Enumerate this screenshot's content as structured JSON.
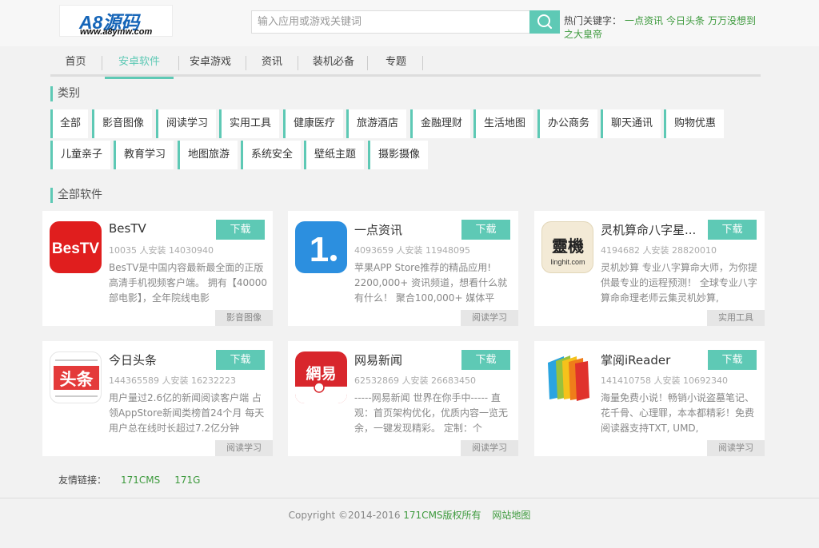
{
  "header": {
    "logo_main": "A8源码",
    "logo_url": "www.a8ymw.com",
    "search_placeholder": "输入应用或游戏关键词",
    "hot_label": "热门关键字：",
    "hot_keywords": [
      "一点资讯",
      "今日头条",
      "万万没想到之大皇帝"
    ]
  },
  "nav": [
    "首页",
    "安卓软件",
    "安卓游戏",
    "资讯",
    "装机必备",
    "专题"
  ],
  "nav_active": "安卓软件",
  "category_title": "类别",
  "categories": [
    "全部",
    "影音图像",
    "阅读学习",
    "实用工具",
    "健康医疗",
    "旅游酒店",
    "金融理财",
    "生活地图",
    "办公商务",
    "聊天通讯",
    "购物优惠",
    "儿童亲子",
    "教育学习",
    "地图旅游",
    "系统安全",
    "壁纸主题",
    "摄影摄像"
  ],
  "list_title": "全部软件",
  "download_label": "下载",
  "apps": [
    {
      "name": "BesTV",
      "stats": "10035 人安装 14030940",
      "desc": "BesTV是中国内容最新最全面的正版高清手机视频客户端。 拥有【40000部电影】，全年院线电影",
      "category": "影音图像",
      "icon": "bestv-icon"
    },
    {
      "name": "一点资讯",
      "stats": "4093659 人安装 11948095",
      "desc": "苹果APP Store推荐的精品应用! 2200,000+ 资讯频道，想看什么就有什么！ 聚合100,000+ 媒体平",
      "category": "阅读学习",
      "icon": "yidian-icon"
    },
    {
      "name": "灵机算命八字星...",
      "stats": "4194682 人安装 28820010",
      "desc": "灵机妙算 专业八字算命大师，为你提供最专业的运程预测！ 全球专业八字算命命理老师云集灵机妙算,",
      "category": "实用工具",
      "icon": "lingji-icon",
      "icon_text": "靈機",
      "icon_sub": "linghit.com"
    },
    {
      "name": "今日头条",
      "stats": "144365589 人安装 16232223",
      "desc": "用户量过2.6亿的新闻阅读客户端 占领AppStore新闻类榜首24个月 每天用户总在线时长超过7.2亿分钟",
      "category": "阅读学习",
      "icon": "toutiao-icon",
      "icon_text": "头条"
    },
    {
      "name": "网易新闻",
      "stats": "62532869 人安装 26683450",
      "desc": "-----网易新闻 世界在你手中----- 直观：首页架构优化，优质内容一览无余，一键发现精彩。 定制：个",
      "category": "阅读学习",
      "icon": "netease-news-icon",
      "icon_text": "網易"
    },
    {
      "name": "掌阅iReader",
      "stats": "141410758 人安装 10692340",
      "desc": "海量免费小说！畅销小说盗墓笔记、花千骨、心理罪，本本都精彩！免费阅读器支持TXT, UMD,",
      "category": "阅读学习",
      "icon": "ireader-icon"
    }
  ],
  "friend_links_label": "友情链接：",
  "friend_links": [
    "171CMS",
    "171G"
  ],
  "footer": {
    "copyright": "Copyright ©2014-2016",
    "brand": "171CMS版权所有",
    "sitemap": "网站地图"
  },
  "colors": {
    "accent": "#5ec9b5",
    "link_green": "#3d9a3d"
  }
}
